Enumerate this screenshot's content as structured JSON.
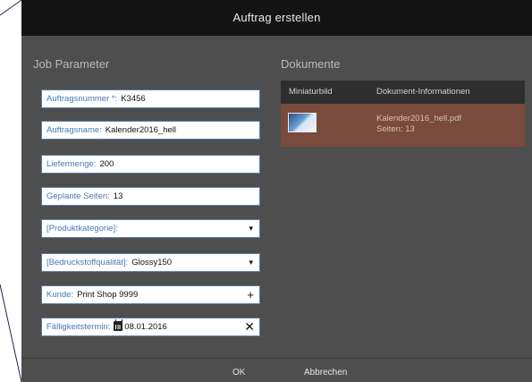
{
  "dialog": {
    "title": "Auftrag erstellen"
  },
  "job": {
    "section_title": "Job Parameter",
    "fields": {
      "order_number": {
        "label": "Auftragsnummer *:",
        "value": "K3456"
      },
      "order_name": {
        "label": "Auftragsname:",
        "value": "Kalender2016_hell"
      },
      "quantity": {
        "label": "Liefermenge:",
        "value": "200"
      },
      "planned_pages": {
        "label": "Geplante Seiten:",
        "value": "13"
      },
      "product_category": {
        "label": "[Produktkategorie]:",
        "value": ""
      },
      "substrate_quality": {
        "label": "[Bedruckstoffqualität]:",
        "value": "Glossy150"
      },
      "customer": {
        "label": "Kunde:",
        "value": "Print Shop  9999"
      },
      "due_date": {
        "label": "Fälligkeitstermin:",
        "value": "08.01.2016"
      }
    },
    "glyphs": {
      "dropdown": "▾",
      "add": "+",
      "clear": "✕"
    }
  },
  "documents": {
    "section_title": "Dokumente",
    "columns": [
      "Miniaturbild",
      "Dokument-Informationen"
    ],
    "rows": [
      {
        "filename": "Kalender2016_hell.pdf",
        "pages": "Seiten: 13"
      }
    ]
  },
  "footer": {
    "ok_label": "OK",
    "cancel_label": "Abbrechen"
  },
  "colors": {
    "dialog_bg": "#4e4e4e",
    "titlebar_bg": "#141414",
    "field_label": "#4a78b4",
    "selected_row": "#7a4a3c"
  }
}
